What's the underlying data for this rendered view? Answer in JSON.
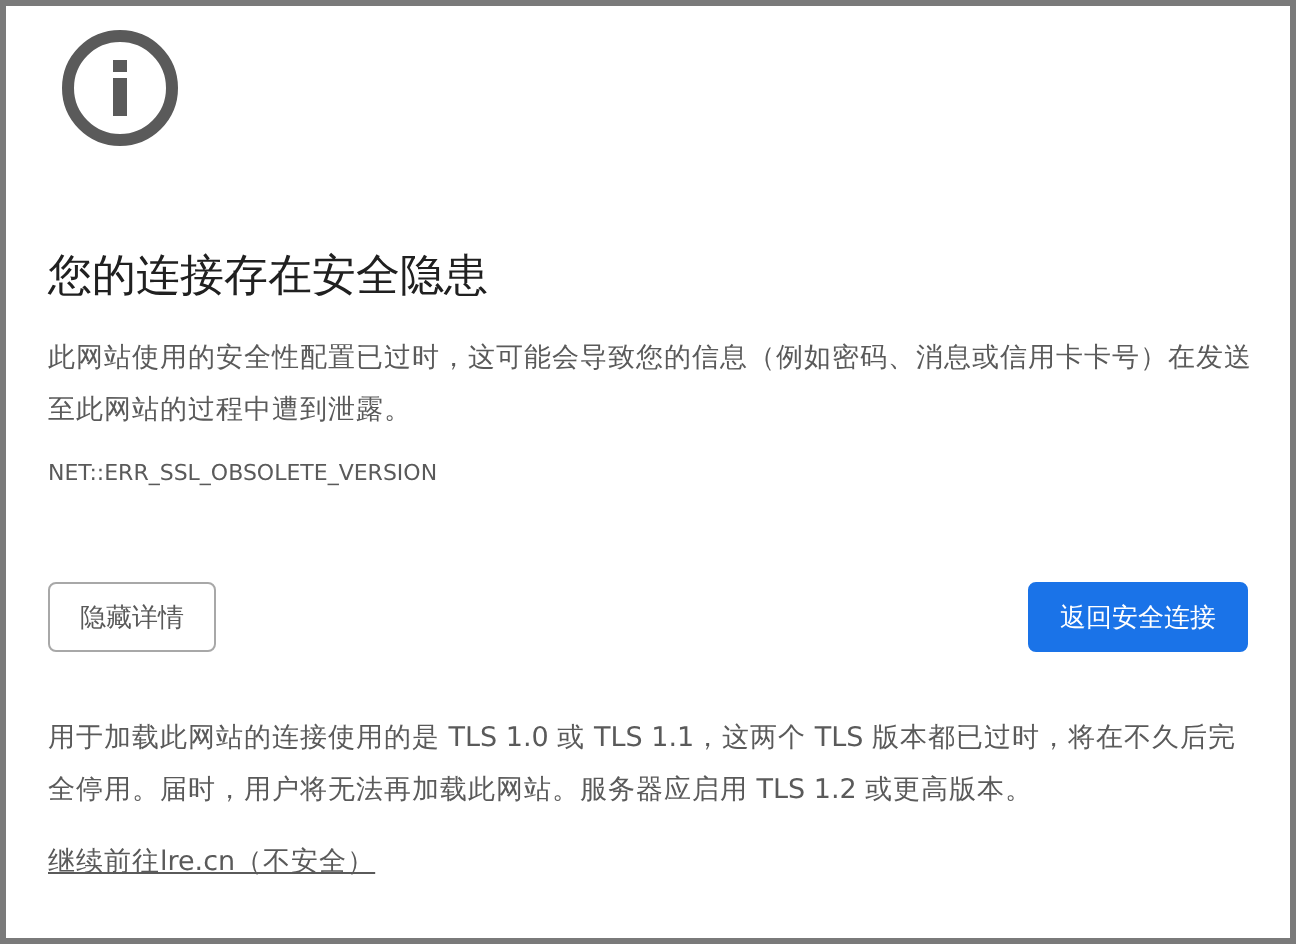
{
  "heading": "您的连接存在安全隐患",
  "description": "此网站使用的安全性配置已过时，这可能会导致您的信息（例如密码、消息或信用卡卡号）在发送至此网站的过程中遭到泄露。",
  "error_code": "NET::ERR_SSL_OBSOLETE_VERSION",
  "buttons": [
    {
      "label": "隐藏详情",
      "kind": "secondary"
    },
    {
      "label": "返回安全连接",
      "kind": "primary"
    }
  ],
  "details": "用于加载此网站的连接使用的是 TLS 1.0 或 TLS 1.1，这两个 TLS 版本都已过时，将在不久后完全停用。届时，用户将无法再加载此网站。服务器应启用 TLS 1.2 或更高版本。",
  "proceed_link": "继续前往lre.cn（不安全）"
}
